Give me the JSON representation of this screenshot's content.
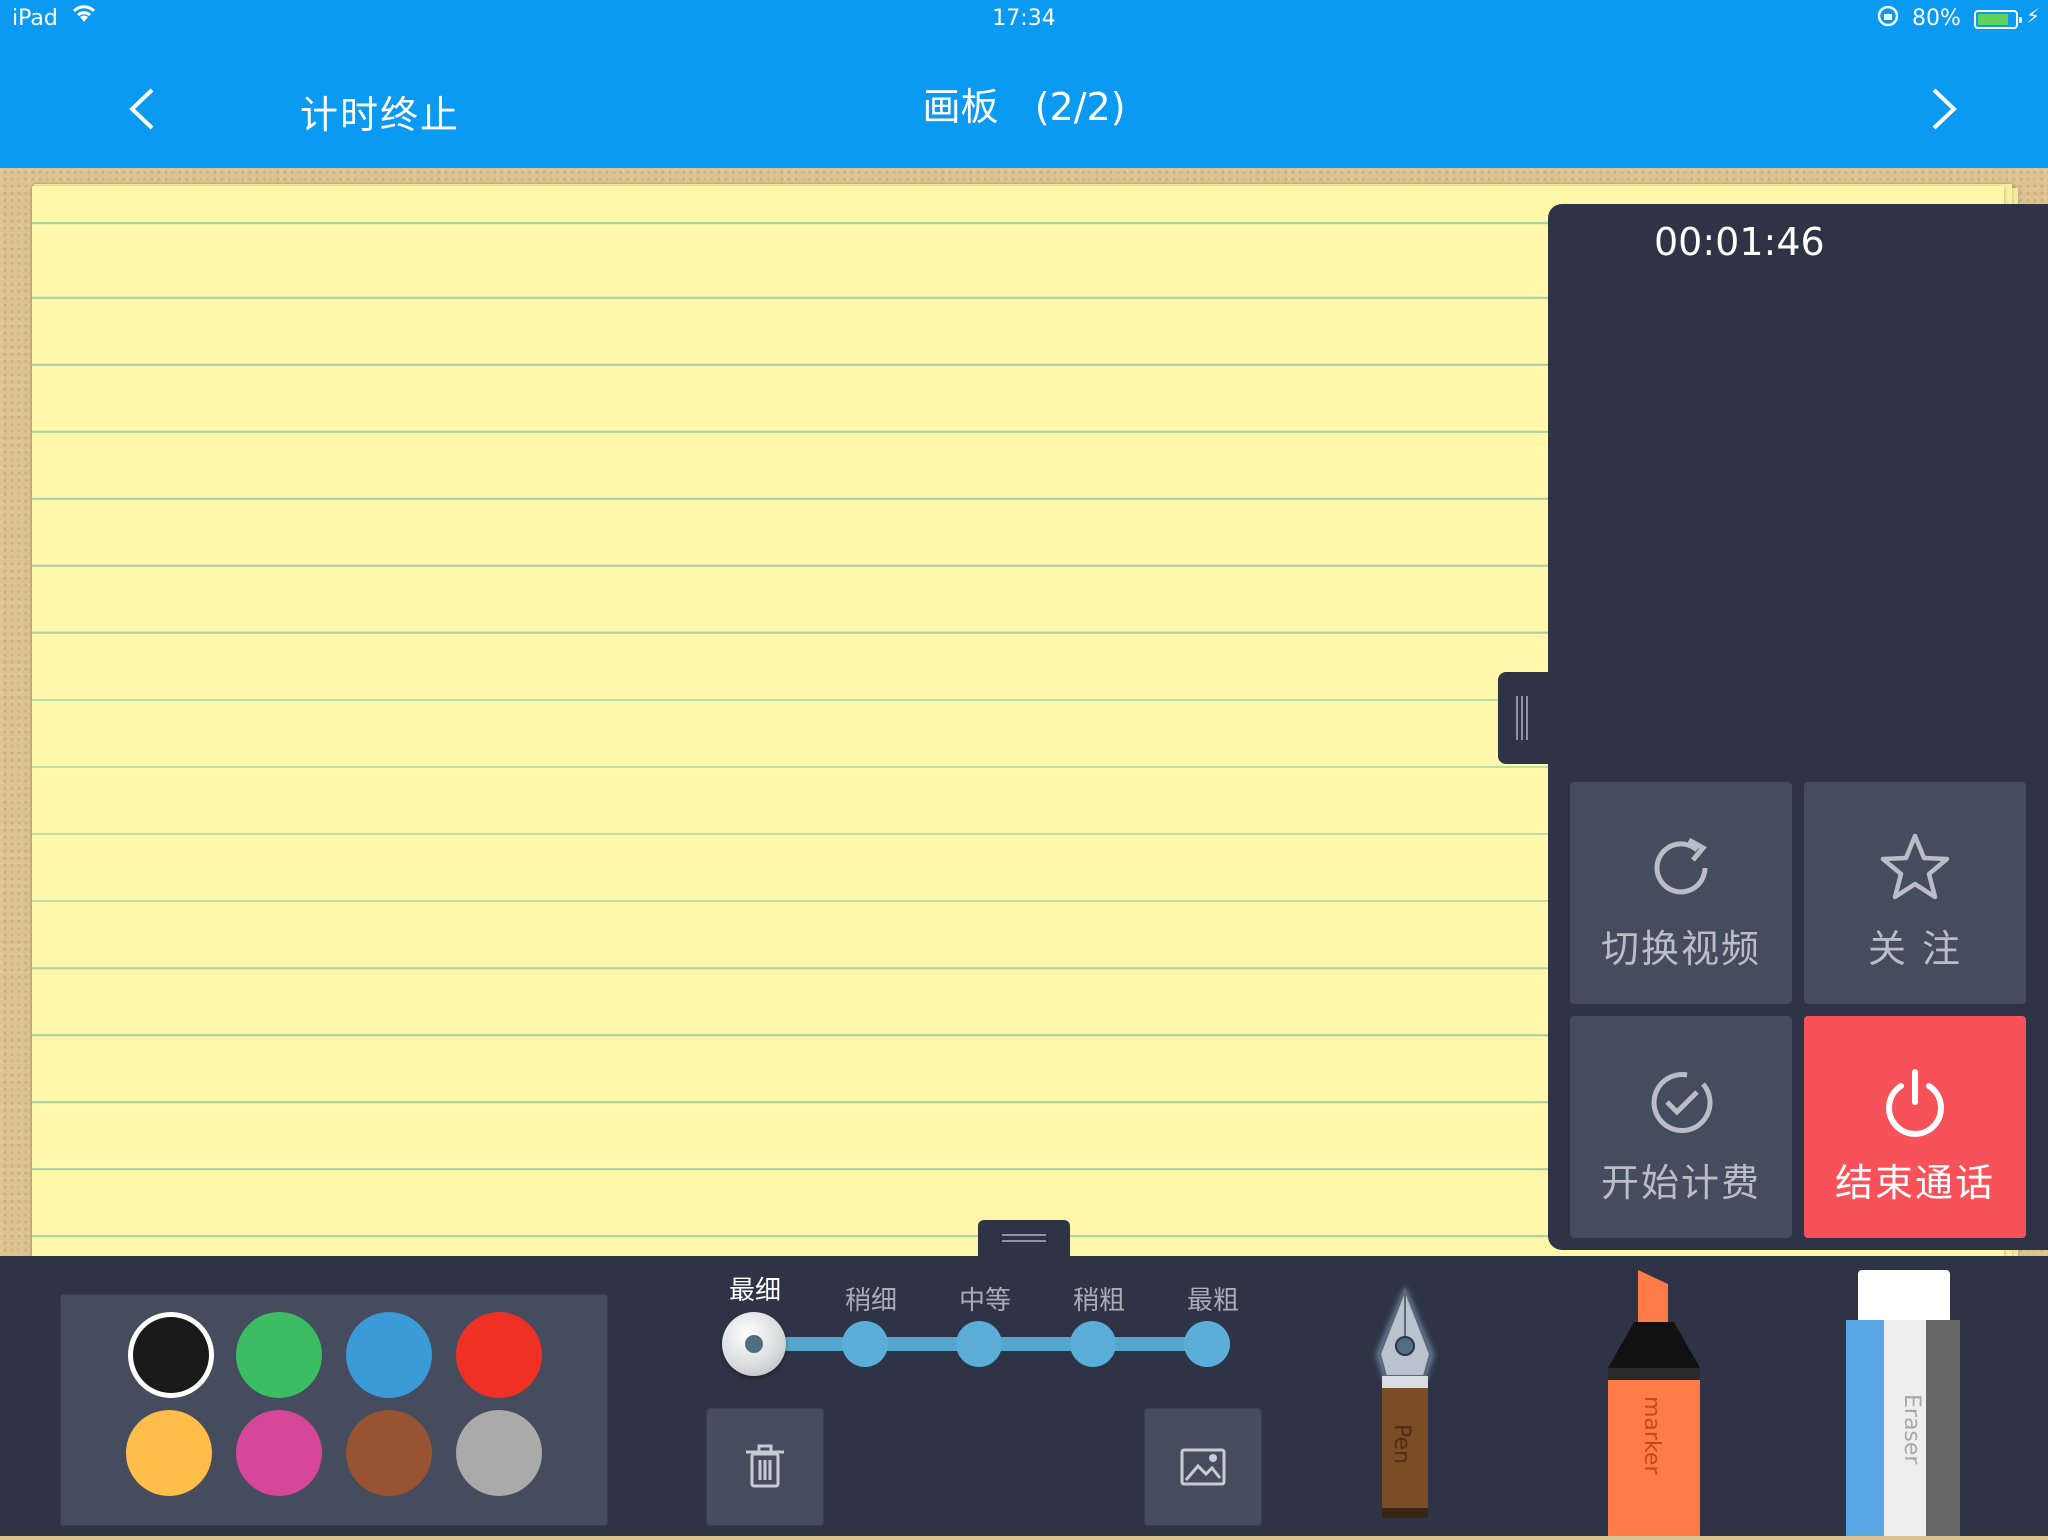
{
  "status_bar": {
    "device": "iPad",
    "time": "17:34",
    "battery": "80%",
    "battery_level": 0.8,
    "icons": [
      "wifi-icon",
      "orientation-lock-icon",
      "battery-icon",
      "charging-icon"
    ]
  },
  "nav": {
    "timer_stop": "计时终止",
    "title": "画板",
    "page_indicator": "(2/2)",
    "back_icon": "chevron-left-icon",
    "forward_icon": "chevron-right-icon"
  },
  "video_panel": {
    "call_timer": "00:01:46",
    "buttons": {
      "switch_video": "切换视频",
      "follow": "关 注",
      "start_billing": "开始计费",
      "end_call": "结束通话"
    }
  },
  "toolbar": {
    "colors": [
      "#1a1a1a",
      "#3dbd63",
      "#3a9bd6",
      "#ef3024",
      "#ffbd4a",
      "#d6479a",
      "#985333",
      "#aaaaaa"
    ],
    "selected_color_index": 0,
    "sizes": [
      "最细",
      "稍细",
      "中等",
      "稍粗",
      "最粗"
    ],
    "selected_size_index": 0,
    "tools": {
      "pen": "Pen",
      "marker": "marker",
      "eraser": "Eraser"
    },
    "accent": "#0b9af2",
    "end_call_color": "#f7525a"
  }
}
